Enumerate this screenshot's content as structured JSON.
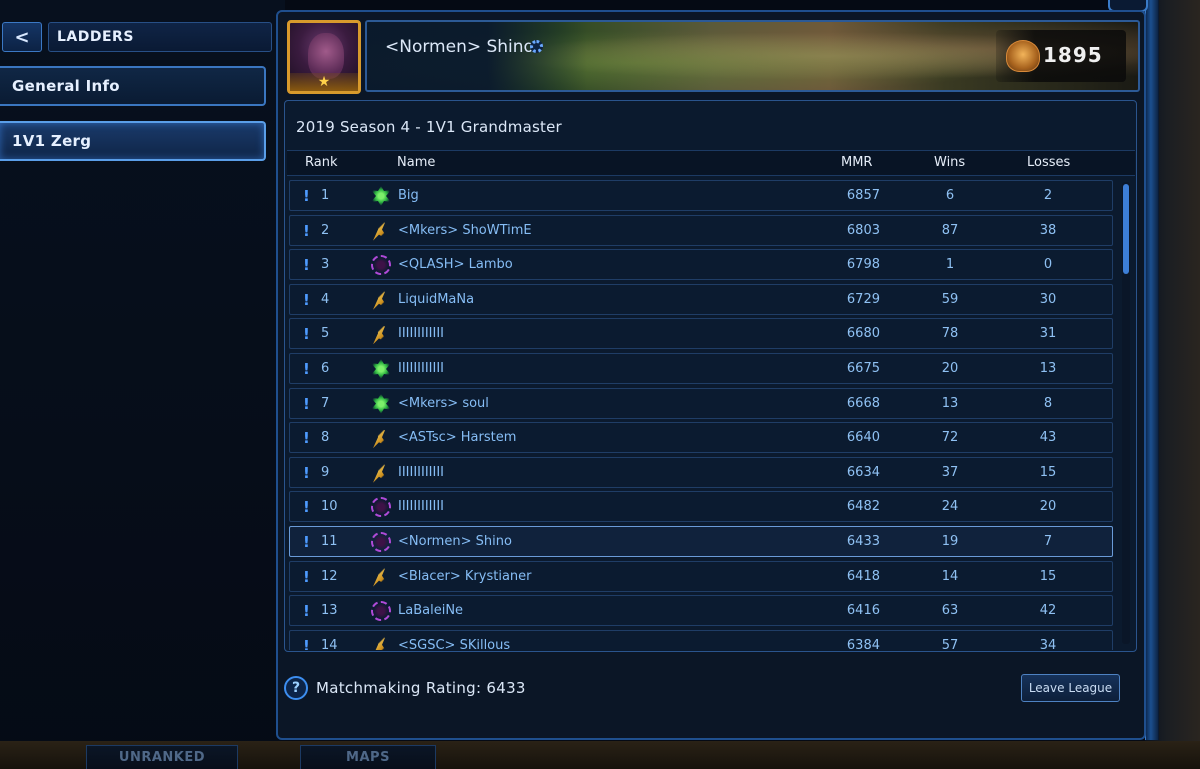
{
  "nav": {
    "back_icon": "chevron-left-icon",
    "back_glyph": "<",
    "ladders_label": "LADDERS",
    "tabs": [
      {
        "label": "General Info"
      },
      {
        "label": "1V1 Zerg"
      }
    ]
  },
  "profile": {
    "player_name": "<Normen> Shino",
    "rating": "1895",
    "league_icon": "grandmaster-icon",
    "portrait_star": "★"
  },
  "ladder": {
    "title": "2019 Season 4 - 1V1 Grandmaster",
    "columns": {
      "rank": "Rank",
      "name": "Name",
      "mmr": "MMR",
      "wins": "Wins",
      "losses": "Losses"
    },
    "rows": [
      {
        "excl": "!",
        "rank": "1",
        "race": "terran",
        "name": "Big",
        "mmr": "6857",
        "wins": "6",
        "losses": "2"
      },
      {
        "excl": "!",
        "rank": "2",
        "race": "protoss",
        "name": "<Mkers> ShoWTimE",
        "mmr": "6803",
        "wins": "87",
        "losses": "38"
      },
      {
        "excl": "!",
        "rank": "3",
        "race": "zerg",
        "name": "<QLASH> Lambo",
        "mmr": "6798",
        "wins": "1",
        "losses": "0"
      },
      {
        "excl": "!",
        "rank": "4",
        "race": "protoss",
        "name": "LiquidMaNa",
        "mmr": "6729",
        "wins": "59",
        "losses": "30"
      },
      {
        "excl": "!",
        "rank": "5",
        "race": "protoss",
        "name": "IIIIIIIIIIII",
        "mmr": "6680",
        "wins": "78",
        "losses": "31"
      },
      {
        "excl": "!",
        "rank": "6",
        "race": "terran",
        "name": "IIIIIIIIIIII",
        "mmr": "6675",
        "wins": "20",
        "losses": "13"
      },
      {
        "excl": "!",
        "rank": "7",
        "race": "terran",
        "name": "<Mkers> soul",
        "mmr": "6668",
        "wins": "13",
        "losses": "8"
      },
      {
        "excl": "!",
        "rank": "8",
        "race": "protoss",
        "name": "<ASTsc> Harstem",
        "mmr": "6640",
        "wins": "72",
        "losses": "43"
      },
      {
        "excl": "!",
        "rank": "9",
        "race": "protoss",
        "name": "IIIIIIIIIIII",
        "mmr": "6634",
        "wins": "37",
        "losses": "15"
      },
      {
        "excl": "!",
        "rank": "10",
        "race": "zerg",
        "name": "IIIIIIIIIIII",
        "mmr": "6482",
        "wins": "24",
        "losses": "20"
      },
      {
        "excl": "!",
        "rank": "11",
        "race": "zerg",
        "name": "<Normen> Shino",
        "mmr": "6433",
        "wins": "19",
        "losses": "7",
        "highlight": true
      },
      {
        "excl": "!",
        "rank": "12",
        "race": "protoss",
        "name": "<Blacer> Krystianer",
        "mmr": "6418",
        "wins": "14",
        "losses": "15"
      },
      {
        "excl": "!",
        "rank": "13",
        "race": "zerg",
        "name": "LaBaleiNe",
        "mmr": "6416",
        "wins": "63",
        "losses": "42"
      },
      {
        "excl": "!",
        "rank": "14",
        "race": "protoss",
        "name": "<SGSC> SKillous",
        "mmr": "6384",
        "wins": "57",
        "losses": "34"
      }
    ]
  },
  "footer": {
    "help_icon": "question-icon",
    "help_glyph": "?",
    "mm_rating_text": "Matchmaking Rating: 6433",
    "leave_label": "Leave League"
  },
  "bottom_tabs": [
    {
      "label": "UNRANKED"
    },
    {
      "label": "MAPS"
    }
  ],
  "colors": {
    "accent": "#3a76c0",
    "highlight_border": "#6a9bd8",
    "row_text": "#86bdf5",
    "gold": "#d89a2c"
  }
}
